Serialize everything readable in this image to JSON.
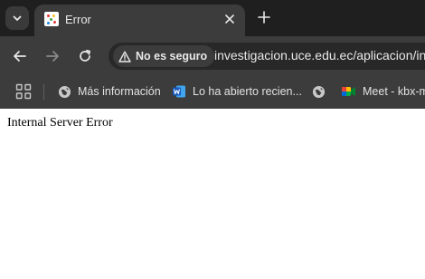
{
  "tab": {
    "title": "Error"
  },
  "toolbar": {
    "security_label": "No es seguro",
    "url": "investigacion.uce.edu.ec/aplicacion/in"
  },
  "bookmarks": [
    {
      "label": "Más información",
      "icon": "globe-icon"
    },
    {
      "label": "Lo ha abierto recien...",
      "icon": "word-icon"
    },
    {
      "label": "",
      "icon": "globe-icon"
    },
    {
      "label": "Meet - kbx-m",
      "icon": "meet-icon"
    }
  ],
  "page": {
    "message": "Internal Server Error"
  },
  "colors": {
    "chrome_dark": "#1f1f1f",
    "toolbar": "#3c3c3c",
    "omnibox": "#282828",
    "text_light": "#e8e8e8",
    "word_blue": "#185abd"
  }
}
